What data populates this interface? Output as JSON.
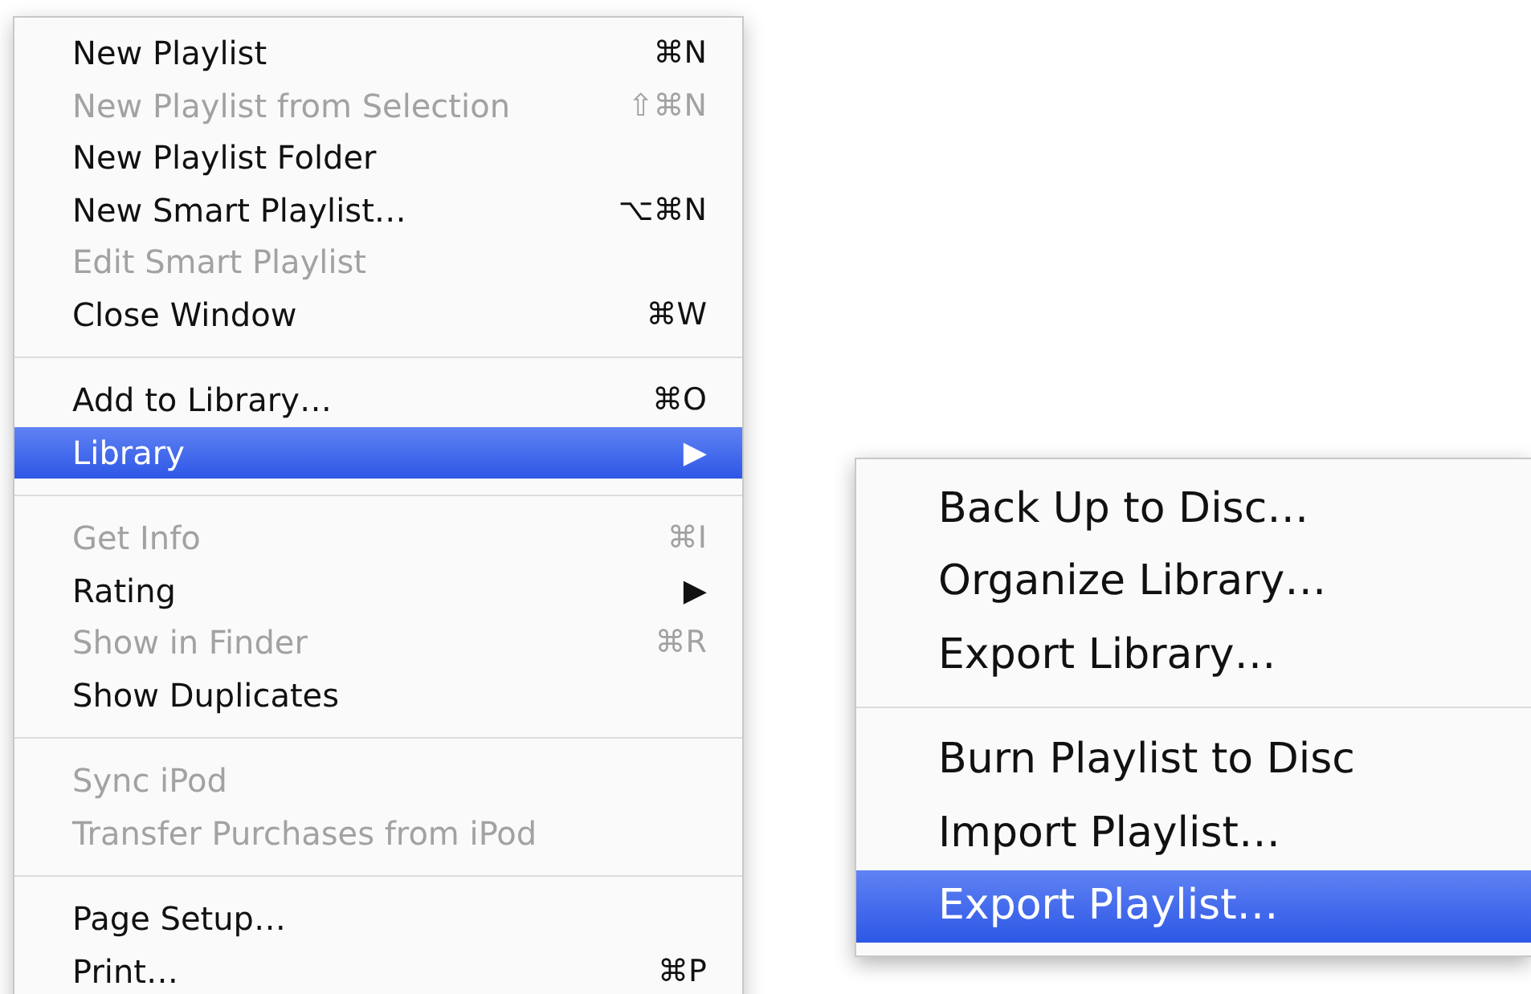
{
  "menu": {
    "sections": [
      [
        {
          "label": "New Playlist",
          "shortcut": "⌘N",
          "disabled": false,
          "selected": false
        },
        {
          "label": "New Playlist from Selection",
          "shortcut": "⇧⌘N",
          "disabled": true,
          "selected": false
        },
        {
          "label": "New Playlist Folder",
          "disabled": false,
          "selected": false
        },
        {
          "label": "New Smart Playlist…",
          "shortcut": "⌥⌘N",
          "disabled": false,
          "selected": false
        },
        {
          "label": "Edit Smart Playlist",
          "disabled": true,
          "selected": false
        },
        {
          "label": "Close Window",
          "shortcut": "⌘W",
          "disabled": false,
          "selected": false
        }
      ],
      [
        {
          "label": "Add to Library…",
          "shortcut": "⌘O",
          "disabled": false,
          "selected": false
        },
        {
          "label": "Library",
          "shortcut": "▶",
          "disabled": false,
          "selected": true
        }
      ],
      [
        {
          "label": "Get Info",
          "shortcut": "⌘I",
          "disabled": true,
          "selected": false
        },
        {
          "label": "Rating",
          "shortcut": "▶",
          "disabled": false,
          "selected": false
        },
        {
          "label": "Show in Finder",
          "shortcut": "⌘R",
          "disabled": true,
          "selected": false
        },
        {
          "label": "Show Duplicates",
          "disabled": false,
          "selected": false
        }
      ],
      [
        {
          "label": "Sync iPod",
          "disabled": true,
          "selected": false
        },
        {
          "label": "Transfer Purchases from iPod",
          "disabled": true,
          "selected": false
        }
      ],
      [
        {
          "label": "Page Setup…",
          "disabled": false,
          "selected": false
        },
        {
          "label": "Print…",
          "shortcut": "⌘P",
          "disabled": false,
          "selected": false
        }
      ]
    ]
  },
  "submenu": {
    "sections": [
      [
        {
          "label": "Back Up to Disc…",
          "disabled": false,
          "selected": false
        },
        {
          "label": "Organize Library…",
          "disabled": false,
          "selected": false
        },
        {
          "label": "Export Library…",
          "disabled": false,
          "selected": false
        }
      ],
      [
        {
          "label": "Burn Playlist to Disc",
          "disabled": false,
          "selected": false
        },
        {
          "label": "Import Playlist…",
          "disabled": false,
          "selected": false
        },
        {
          "label": "Export Playlist…",
          "disabled": false,
          "selected": true
        }
      ]
    ]
  }
}
